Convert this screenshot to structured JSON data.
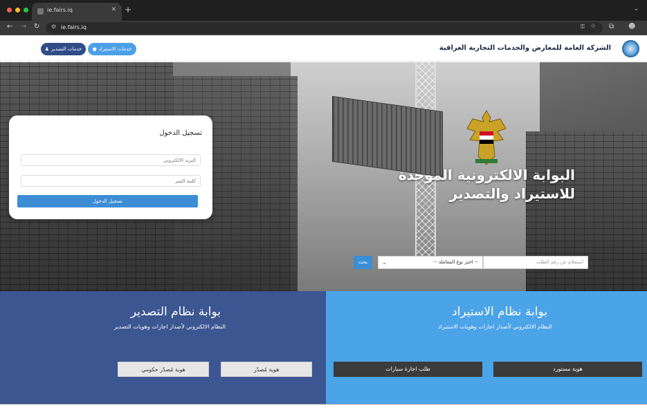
{
  "browser": {
    "tab_title": "ie.fairs.iq",
    "tab_close": "✕",
    "new_tab": "+",
    "url": "ie.fairs.iq",
    "nav": {
      "back": "←",
      "forward": "→",
      "reload": "↻"
    },
    "tab_menu": "⌄"
  },
  "header": {
    "company_name": "الشركة العامة للمعارض والخدمات التجارية العراقية",
    "import_services": "خدمات الاستيراد",
    "export_services": "خدمات التصدير"
  },
  "hero": {
    "title_line1": "البوابة الالكترونية الموحدة",
    "title_line2": "للاستيراد والتصدير"
  },
  "login": {
    "title": "تسجيل الدخول",
    "email_placeholder": "البريد الالكتروني",
    "password_placeholder": "كلمة السر",
    "submit_label": "تسجيل الدخول"
  },
  "search": {
    "request_placeholder": "استعلام عن رقم الطلب",
    "type_placeholder": "-- اختر نوع المعاملة --",
    "button_label": "بحث"
  },
  "export_portal": {
    "title": "بوابة نظام التصدير",
    "subtitle": "النظام الالكتروني لأصدار اجازات وهويات التصدير",
    "btn_exporter_id": "هوية مُصدّر",
    "btn_gov_exporter_id": "هوية مُصدّر حكومي"
  },
  "import_portal": {
    "title": "بوابة نظام الاستيراد",
    "subtitle": "النظام الالكتروني لأصدار اجازات وهويات الاستيراد",
    "btn_importer_id": "هوية مستورد",
    "btn_car_license": "طلب اجازة سيارات"
  },
  "colors": {
    "export_blue": "#3b5691",
    "import_blue": "#4ba3e8",
    "button_blue": "#3c8dd4"
  }
}
